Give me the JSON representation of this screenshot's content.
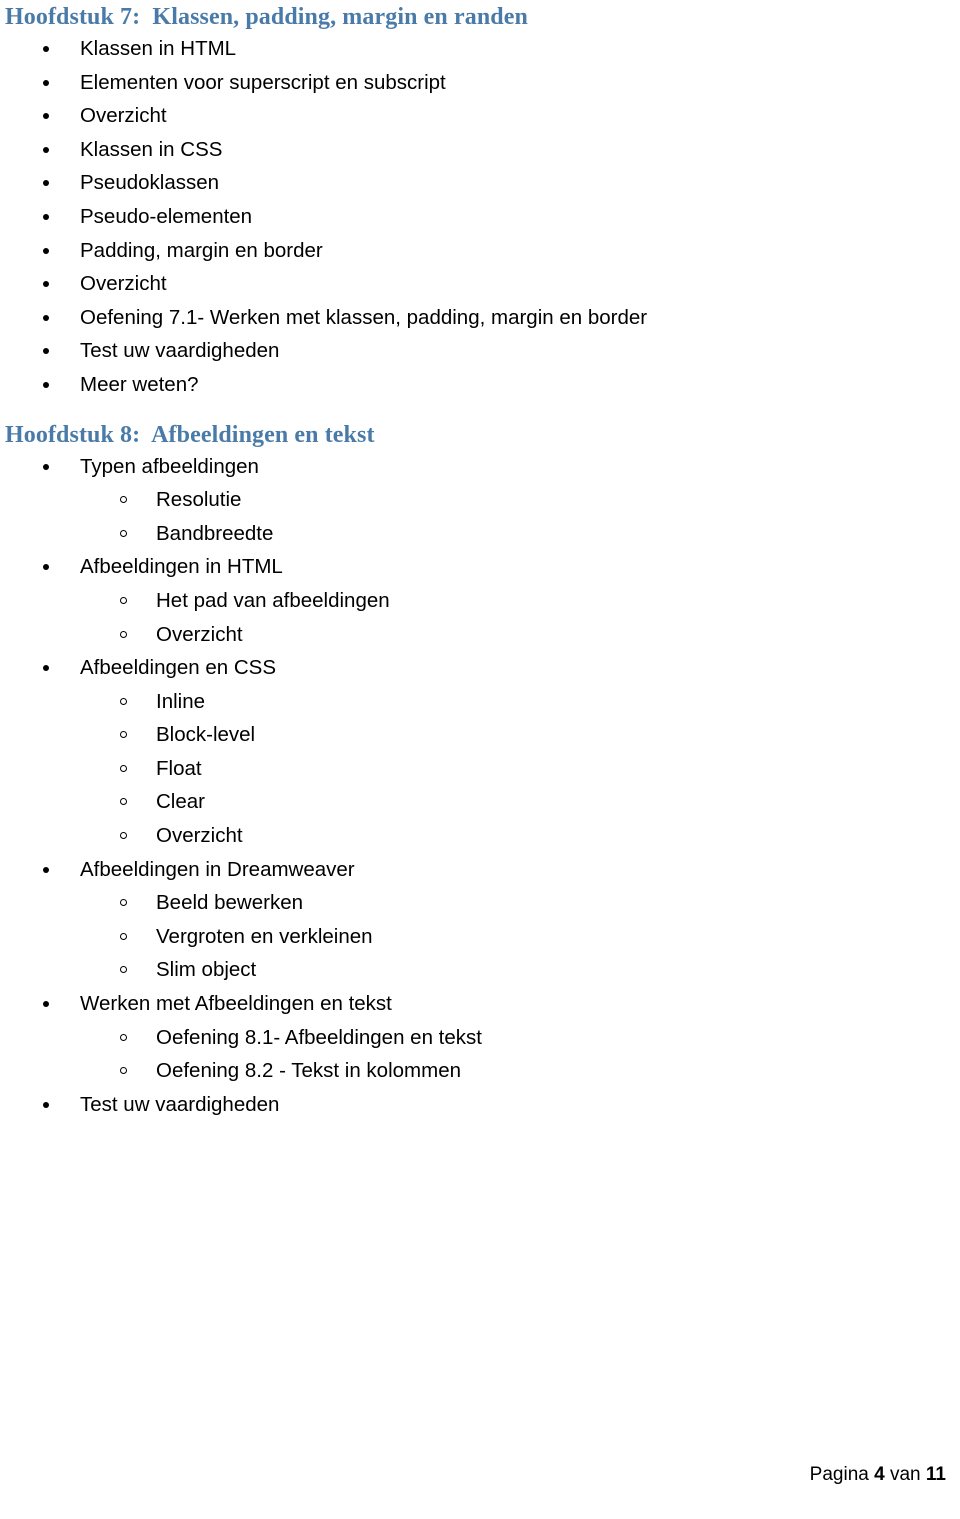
{
  "document": {
    "heading_color": "#4a7ba8",
    "text_color": "#000000",
    "background_color": "#ffffff"
  },
  "chapters": [
    {
      "label": "Hoofdstuk 7:",
      "title": "Klassen, padding, margin en randen",
      "heading_full": "Hoofdstuk 7:  Klassen, padding, margin en randen",
      "items": [
        {
          "level": 1,
          "text": "Klassen in HTML"
        },
        {
          "level": 1,
          "text": "Elementen voor superscript en subscript"
        },
        {
          "level": 1,
          "text": "Overzicht"
        },
        {
          "level": 1,
          "text": "Klassen in CSS"
        },
        {
          "level": 1,
          "text": "Pseudoklassen"
        },
        {
          "level": 1,
          "text": "Pseudo-elementen"
        },
        {
          "level": 1,
          "text": "Padding, margin en border"
        },
        {
          "level": 1,
          "text": "Overzicht"
        },
        {
          "level": 1,
          "text": "Oefening 7.1- Werken met klassen, padding, margin en border"
        },
        {
          "level": 1,
          "text": "Test uw vaardigheden"
        },
        {
          "level": 1,
          "text": "Meer weten?"
        }
      ]
    },
    {
      "label": "Hoofdstuk 8:",
      "title": "Afbeeldingen en tekst",
      "heading_full": "Hoofdstuk 8:  Afbeeldingen en tekst",
      "items": [
        {
          "level": 1,
          "text": "Typen afbeeldingen"
        },
        {
          "level": 2,
          "text": "Resolutie"
        },
        {
          "level": 2,
          "text": "Bandbreedte"
        },
        {
          "level": 1,
          "text": "Afbeeldingen in HTML"
        },
        {
          "level": 2,
          "text": "Het pad van afbeeldingen"
        },
        {
          "level": 2,
          "text": "Overzicht"
        },
        {
          "level": 1,
          "text": "Afbeeldingen en CSS"
        },
        {
          "level": 2,
          "text": "Inline"
        },
        {
          "level": 2,
          "text": "Block-level"
        },
        {
          "level": 2,
          "text": "Float"
        },
        {
          "level": 2,
          "text": "Clear"
        },
        {
          "level": 2,
          "text": "Overzicht"
        },
        {
          "level": 1,
          "text": "Afbeeldingen in Dreamweaver"
        },
        {
          "level": 2,
          "text": "Beeld bewerken"
        },
        {
          "level": 2,
          "text": "Vergroten en verkleinen"
        },
        {
          "level": 2,
          "text": "Slim object"
        },
        {
          "level": 1,
          "text": "Werken met Afbeeldingen en tekst"
        },
        {
          "level": 2,
          "text": "Oefening 8.1- Afbeeldingen en tekst"
        },
        {
          "level": 2,
          "text": "Oefening 8.2 - Tekst in kolommen"
        },
        {
          "level": 1,
          "text": "Test uw vaardigheden"
        }
      ]
    }
  ],
  "footer": {
    "prefix": "Pagina ",
    "page_number": "4",
    "middle": " van ",
    "total_pages": "11",
    "full": "Pagina 4 van 11"
  }
}
